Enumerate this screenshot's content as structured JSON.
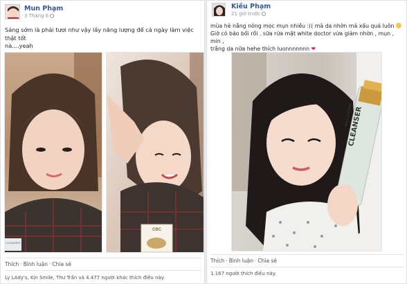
{
  "left_post": {
    "author": "Mun Phạm",
    "date": "3 Tháng 6",
    "text_line1": "Sáng sớm là phải tươi như vậy lấy năng lượng để cả ngày làm việc thật tốt",
    "text_line2": "nà....yeah",
    "actions": {
      "like": "Thích",
      "comment": "Bình luận",
      "share": "Chia sẻ"
    },
    "likes_text": "Ly LAdy's, Kịn Smile, Thư Trần và 4.477 người khác thích điều này.",
    "product_label_1": "CLEANSER",
    "product_label_2": "CBC"
  },
  "right_post": {
    "author": "Kiều Phạm",
    "date": "21 giờ trước",
    "text_line1": "mùa hè nắng nóng mọc mụn nhiều :(( mà da nhờn mà xấu quá luôn",
    "text_line2": "Giờ có bảo bối rồi . sữa rửa mặt white doctor vừa giảm nhờn , mụn , min ,",
    "text_line3": "trắng da nữa hehe thích luonnnnnnn",
    "heart": "❤",
    "actions": {
      "like": "Thích",
      "comment": "Bình luận",
      "share": "Chia sẻ"
    },
    "likes_text": "1.167 người thích điều này.",
    "product_label": "CLEANSER",
    "product_brand": "WHITE DOCTORS"
  },
  "colors": {
    "link": "#365899",
    "meta": "#90949c",
    "heart": "#e0245e",
    "background": "#e9ebee"
  }
}
